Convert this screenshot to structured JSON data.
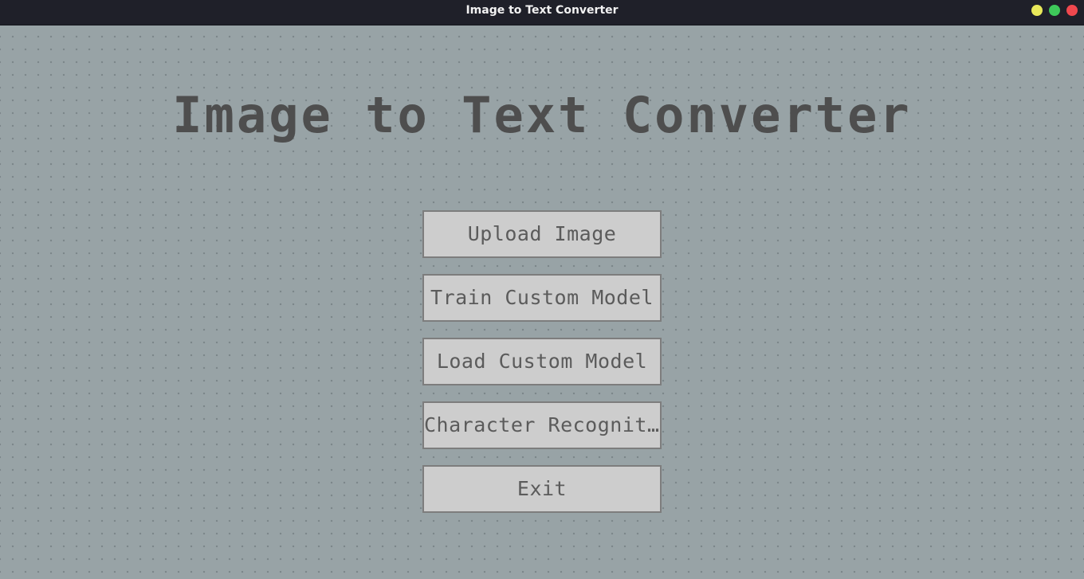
{
  "window": {
    "title": "Image to Text Converter",
    "controls": [
      {
        "name": "minimize",
        "color": "#e8e85a"
      },
      {
        "name": "maximize",
        "color": "#3ec95a"
      },
      {
        "name": "close",
        "color": "#f0484e"
      }
    ]
  },
  "main": {
    "heading": "Image to Text Converter",
    "buttons": [
      {
        "label": "Upload Image"
      },
      {
        "label": "Train Custom Model"
      },
      {
        "label": "Load Custom Model"
      },
      {
        "label": "Character Recogniti..."
      },
      {
        "label": "Exit"
      }
    ]
  },
  "colors": {
    "background": "#98a3a6",
    "titlebar": "#1f2029",
    "heading_text": "#4e4e4e",
    "button_fill": "#cdcdcd",
    "button_border": "#7d7d7d",
    "button_text": "#5b5b5b"
  }
}
